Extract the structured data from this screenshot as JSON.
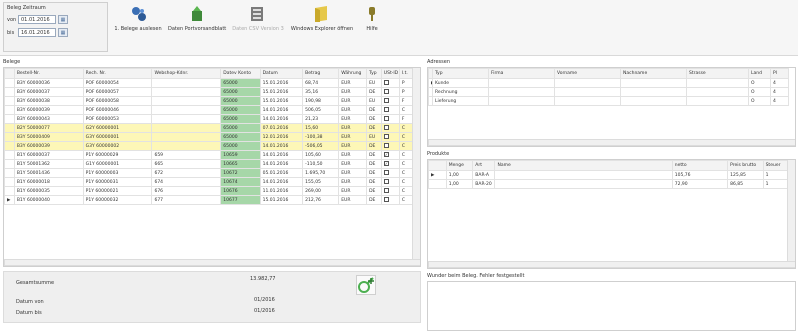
{
  "toolbar": {
    "date_group_title": "Beleg Zeitraum",
    "from_label": "von",
    "from_value": "01.01.2016",
    "to_label": "bis",
    "to_value": "16.01.2016",
    "buttons": [
      {
        "label": "1. Belege auslesen"
      },
      {
        "label": "Daten Portvorsandblatt"
      },
      {
        "label": "Daten CSV Version 3"
      },
      {
        "label": "Windows Explorer öffnen"
      },
      {
        "label": "Hilfe"
      }
    ]
  },
  "belege": {
    "title": "Belege",
    "columns": [
      "Bestell-Nr.",
      "Rech. Nr.",
      "Webshop-Kdnr.",
      "Datev Konto",
      "Datum",
      "Betrag",
      "Währung",
      "Typ",
      "USt-ID",
      "I.t."
    ],
    "rows": [
      {
        "bestell": "B3Y 60000036",
        "rech": "POF 60000054",
        "webshop": "",
        "datev": "65000",
        "datum": "15.01.2016",
        "betrag": "68,74",
        "waehrung": "EUR",
        "typ": "EU",
        "checked": false,
        "it": "P",
        "highlight": false
      },
      {
        "bestell": "B3Y 60000037",
        "rech": "POF 60000057",
        "webshop": "",
        "datev": "65000",
        "datum": "15.01.2016",
        "betrag": "35,16",
        "waehrung": "EUR",
        "typ": "DE",
        "checked": false,
        "it": "P",
        "highlight": false
      },
      {
        "bestell": "B3Y 60000038",
        "rech": "POF 60000058",
        "webshop": "",
        "datev": "65000",
        "datum": "15.01.2016",
        "betrag": "190,98",
        "waehrung": "EUR",
        "typ": "EU",
        "checked": false,
        "it": "F",
        "highlight": false
      },
      {
        "bestell": "B3Y 60000039",
        "rech": "POF 60000046",
        "webshop": "",
        "datev": "65000",
        "datum": "14.01.2016",
        "betrag": "506,05",
        "waehrung": "EUR",
        "typ": "DE",
        "checked": false,
        "it": "C",
        "highlight": false
      },
      {
        "bestell": "B3Y 60000043",
        "rech": "POF 60000053",
        "webshop": "",
        "datev": "65000",
        "datum": "14.01.2016",
        "betrag": "21,23",
        "waehrung": "EUR",
        "typ": "DE",
        "checked": false,
        "it": "F",
        "highlight": false
      },
      {
        "bestell": "B2Y 50000077",
        "rech": "G2Y 60000001",
        "webshop": "",
        "datev": "65000",
        "datum": "07.01.2016",
        "betrag": "15,60",
        "waehrung": "EUR",
        "typ": "DE",
        "checked": false,
        "it": "C",
        "highlight": true
      },
      {
        "bestell": "B3Y 50000409",
        "rech": "G3Y 60000001",
        "webshop": "",
        "datev": "65000",
        "datum": "12.01.2016",
        "betrag": "-100,38",
        "waehrung": "EUR",
        "typ": "EU",
        "checked": false,
        "it": "C",
        "highlight": true
      },
      {
        "bestell": "B3Y 60000039",
        "rech": "G3Y 60000002",
        "webshop": "",
        "datev": "65000",
        "datum": "14.01.2016",
        "betrag": "-506,05",
        "waehrung": "EUR",
        "typ": "DE",
        "checked": false,
        "it": "C",
        "highlight": true
      },
      {
        "bestell": "B1Y 60000037",
        "rech": "P1Y 60000029",
        "webshop": "659",
        "datev": "10659",
        "datum": "14.01.2016",
        "betrag": "105,60",
        "waehrung": "EUR",
        "typ": "DE",
        "checked": true,
        "it": "C",
        "highlight": false
      },
      {
        "bestell": "B1Y 50001362",
        "rech": "G1Y 60000001",
        "webshop": "665",
        "datev": "10665",
        "datum": "14.01.2016",
        "betrag": "-110,50",
        "waehrung": "EUR",
        "typ": "DE",
        "checked": true,
        "it": "C",
        "highlight": false
      },
      {
        "bestell": "B1Y 50001436",
        "rech": "P1Y 60000003",
        "webshop": "672",
        "datev": "10672",
        "datum": "05.01.2016",
        "betrag": "1.695,70",
        "waehrung": "EUR",
        "typ": "DE",
        "checked": false,
        "it": "C",
        "highlight": false
      },
      {
        "bestell": "B1Y 60000018",
        "rech": "P1Y 60000031",
        "webshop": "674",
        "datev": "10674",
        "datum": "14.01.2016",
        "betrag": "155,05",
        "waehrung": "EUR",
        "typ": "DE",
        "checked": false,
        "it": "C",
        "highlight": false
      },
      {
        "bestell": "B1Y 60000035",
        "rech": "P1Y 60000021",
        "webshop": "676",
        "datev": "10676",
        "datum": "11.01.2016",
        "betrag": "269,00",
        "waehrung": "EUR",
        "typ": "DE",
        "checked": false,
        "it": "C",
        "highlight": false
      },
      {
        "bestell": "B1Y 60000040",
        "rech": "P1Y 60000032",
        "webshop": "677",
        "datev": "10677",
        "datum": "15.01.2016",
        "betrag": "212,76",
        "waehrung": "EUR",
        "typ": "DE",
        "checked": false,
        "it": "C",
        "highlight": false,
        "current": true
      }
    ]
  },
  "summary": {
    "gesamtsumme_label": "Gesamtsumme",
    "gesamtsumme_value": "13.982,77",
    "datum_von_label": "Datum von",
    "datum_von_value": "01/2016",
    "datum_bis_label": "Datum bis",
    "datum_bis_value": "01/2016"
  },
  "adressen": {
    "title": "Adressen",
    "columns": [
      "Typ",
      "Firma",
      "Vorname",
      "Nachname",
      "Strasse",
      "Land",
      "Pl"
    ],
    "rows": [
      {
        "typ": "Kunde",
        "land": "O",
        "pl": "4"
      },
      {
        "typ": "Rechnung",
        "land": "O",
        "pl": "4"
      },
      {
        "typ": "Lieferung",
        "land": "O",
        "pl": "4"
      }
    ]
  },
  "produkte": {
    "title": "Produkte",
    "columns": [
      "Menge",
      "Art",
      "Name",
      "netto",
      "Preis brutto",
      "Steuer"
    ],
    "rows": [
      {
        "menge": "1,00",
        "art": "BAR-A",
        "netto": "105,76",
        "preis": "125,85",
        "steuer": "1"
      },
      {
        "menge": "1,00",
        "art": "BAR-20",
        "netto": "72,90",
        "preis": "86,85",
        "steuer": "1"
      }
    ]
  },
  "status": {
    "text": "Wunder beim Beleg. Fehler festgestellt"
  }
}
